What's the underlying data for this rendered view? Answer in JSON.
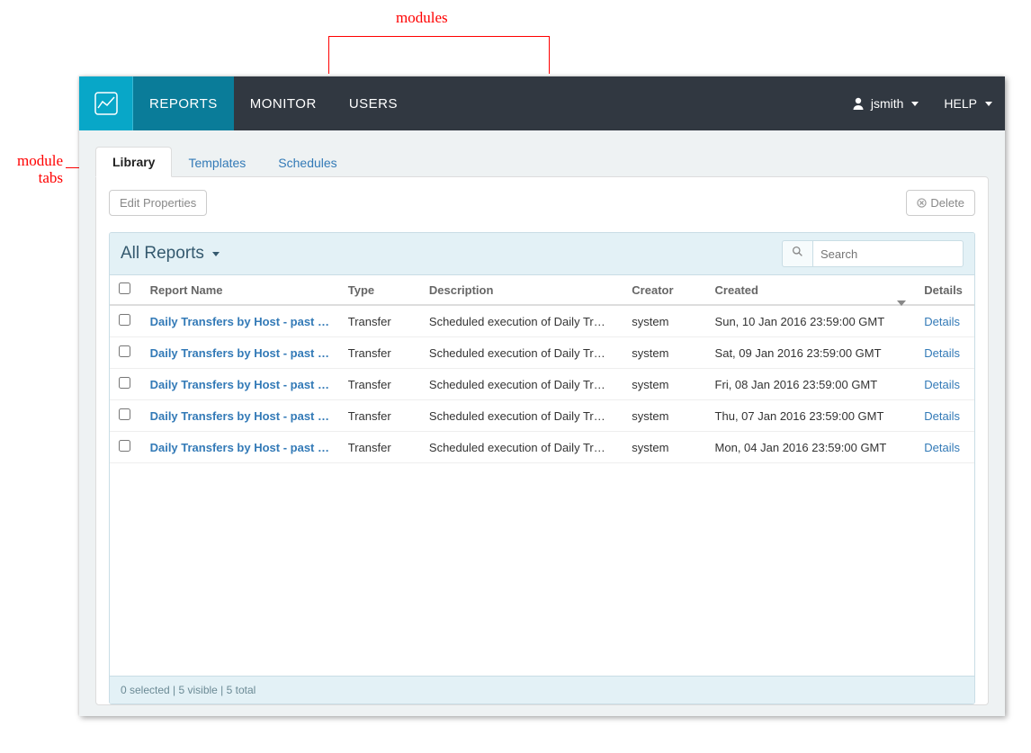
{
  "annotations": {
    "modules": "modules",
    "module_tabs_line1": "module",
    "module_tabs_line2": "tabs"
  },
  "nav": {
    "items": [
      "REPORTS",
      "MONITOR",
      "USERS"
    ],
    "user": "jsmith",
    "help": "HELP"
  },
  "tabs": [
    "Library",
    "Templates",
    "Schedules"
  ],
  "toolbar": {
    "edit_properties": "Edit Properties",
    "delete": "Delete"
  },
  "table": {
    "title": "All Reports",
    "search_placeholder": "Search",
    "columns": {
      "report_name": "Report Name",
      "type": "Type",
      "description": "Description",
      "creator": "Creator",
      "created": "Created",
      "details": "Details"
    },
    "rows": [
      {
        "name": "Daily Transfers by Host - past …",
        "type": "Transfer",
        "desc": "Scheduled execution of Daily Tr…",
        "creator": "system",
        "created": "Sun, 10 Jan 2016 23:59:00 GMT",
        "details": "Details"
      },
      {
        "name": "Daily Transfers by Host - past …",
        "type": "Transfer",
        "desc": "Scheduled execution of Daily Tr…",
        "creator": "system",
        "created": "Sat, 09 Jan 2016 23:59:00 GMT",
        "details": "Details"
      },
      {
        "name": "Daily Transfers by Host - past …",
        "type": "Transfer",
        "desc": "Scheduled execution of Daily Tr…",
        "creator": "system",
        "created": "Fri, 08 Jan 2016 23:59:00 GMT",
        "details": "Details"
      },
      {
        "name": "Daily Transfers by Host - past …",
        "type": "Transfer",
        "desc": "Scheduled execution of Daily Tr…",
        "creator": "system",
        "created": "Thu, 07 Jan 2016 23:59:00 GMT",
        "details": "Details"
      },
      {
        "name": "Daily Transfers by Host - past …",
        "type": "Transfer",
        "desc": "Scheduled execution of Daily Tr…",
        "creator": "system",
        "created": "Mon, 04 Jan 2016 23:59:00 GMT",
        "details": "Details"
      }
    ],
    "status": "0 selected  |  5 visible  |  5 total"
  }
}
